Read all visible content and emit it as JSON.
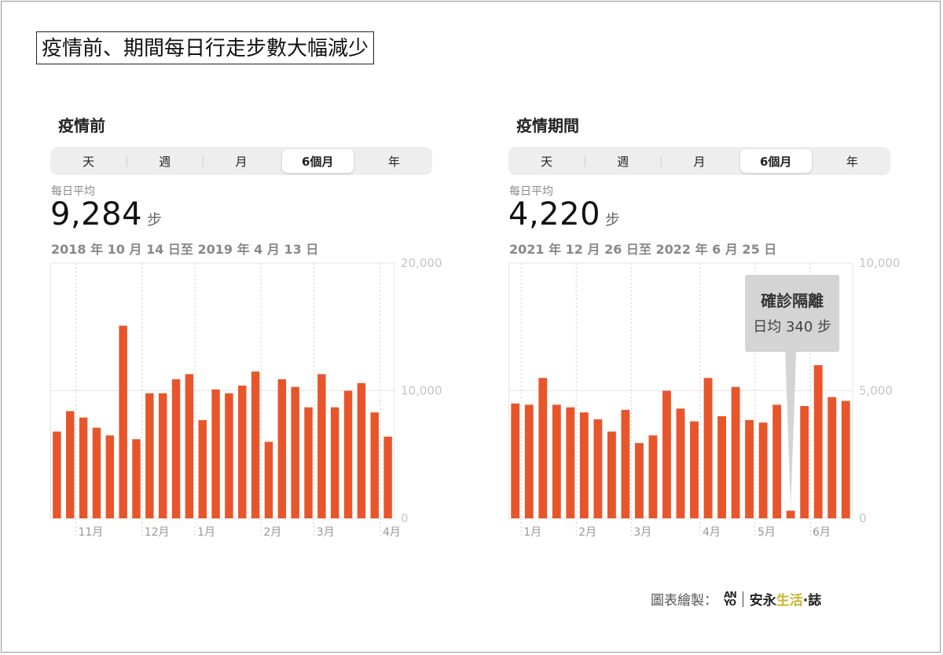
{
  "main_title": "疫情前、期間每日行走步數大幅減少",
  "credit": {
    "label": "圖表繪製：",
    "logo_top": "AN",
    "logo_bottom": "YO",
    "brand_a": "安永",
    "brand_b": "生活",
    "brand_c": "·誌",
    "brand_highlight_color": "#c9b530"
  },
  "colors": {
    "bar": "#e8552b",
    "grid": "#e5e5e5",
    "tooltip_bg": "#d4d4d4"
  },
  "panels": [
    {
      "title": "疫情前",
      "segments": [
        "天",
        "週",
        "月",
        "6個月",
        "年"
      ],
      "active_segment": "6個月",
      "avg_label": "每日平均",
      "avg_value": "9,284",
      "avg_unit": "步",
      "date_range": "2018 年 10 月 14 日至 2019 年 4 月 13 日"
    },
    {
      "title": "疫情期間",
      "segments": [
        "天",
        "週",
        "月",
        "6個月",
        "年"
      ],
      "active_segment": "6個月",
      "avg_label": "每日平均",
      "avg_value": "4,220",
      "avg_unit": "步",
      "date_range": "2021 年 12 月 26 日至 2022 年 6 月 25 日"
    }
  ],
  "chart_data": [
    {
      "type": "bar",
      "ylim": [
        0,
        20000
      ],
      "yticks": [
        "20,000",
        "10,000",
        "0"
      ],
      "ytick_values": [
        20000,
        10000,
        0
      ],
      "xlabels": [
        "11月",
        "12月",
        "1月",
        "2月",
        "3月",
        "4月"
      ],
      "xlabel_week_index": [
        2,
        7,
        11,
        16,
        20,
        25
      ],
      "values": [
        6800,
        8400,
        7900,
        7100,
        6500,
        15100,
        6200,
        9800,
        9800,
        10900,
        11300,
        7700,
        10100,
        9800,
        10400,
        11500,
        6000,
        10900,
        10300,
        8700,
        11300,
        8700,
        10000,
        10600,
        8300,
        6400
      ]
    },
    {
      "type": "bar",
      "ylim": [
        0,
        10000
      ],
      "yticks": [
        "10,000",
        "5,000",
        "0"
      ],
      "ytick_values": [
        10000,
        5000,
        0
      ],
      "xlabels": [
        "1月",
        "2月",
        "3月",
        "4月",
        "5月",
        "6月"
      ],
      "xlabel_week_index": [
        1,
        5,
        9,
        14,
        18,
        22
      ],
      "values": [
        4500,
        4450,
        5500,
        4450,
        4350,
        4150,
        3880,
        3400,
        4250,
        2950,
        3250,
        5000,
        4300,
        3800,
        5500,
        4000,
        5150,
        3850,
        3750,
        4450,
        300,
        4400,
        6000,
        4750,
        4600
      ],
      "annotation": {
        "title": "確診隔離",
        "text": "日均 340 步",
        "bar_index": 20
      }
    }
  ]
}
